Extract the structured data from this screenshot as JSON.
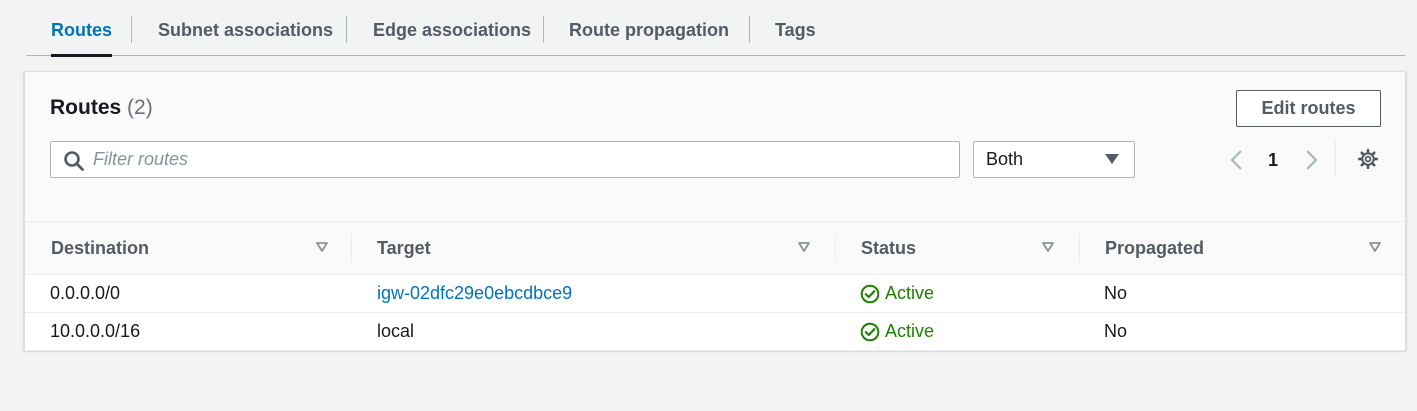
{
  "tabs": [
    {
      "label": "Routes",
      "active": true
    },
    {
      "label": "Subnet associations",
      "active": false
    },
    {
      "label": "Edge associations",
      "active": false
    },
    {
      "label": "Route propagation",
      "active": false
    },
    {
      "label": "Tags",
      "active": false
    }
  ],
  "panel": {
    "title": "Routes",
    "count": "(2)",
    "edit_button": "Edit routes"
  },
  "filter": {
    "placeholder": "Filter routes",
    "value": ""
  },
  "select": {
    "value": "Both"
  },
  "pagination": {
    "current_page": "1"
  },
  "table": {
    "columns": [
      "Destination",
      "Target",
      "Status",
      "Propagated"
    ],
    "rows": [
      {
        "destination": "0.0.0.0/0",
        "target": "igw-02dfc29e0ebcdbce9",
        "target_is_link": true,
        "status": "Active",
        "propagated": "No"
      },
      {
        "destination": "10.0.0.0/16",
        "target": "local",
        "target_is_link": false,
        "status": "Active",
        "propagated": "No"
      }
    ]
  },
  "colors": {
    "accent": "#0073bb",
    "success": "#1d8102",
    "text": "#16191f",
    "muted": "#545b64"
  },
  "icons": {
    "search": "search-icon",
    "dropdown": "caret-down-icon",
    "prev": "chevron-left-icon",
    "next": "chevron-right-icon",
    "settings": "gear-icon",
    "sort": "sort-caret-icon",
    "status": "check-circle-icon"
  }
}
